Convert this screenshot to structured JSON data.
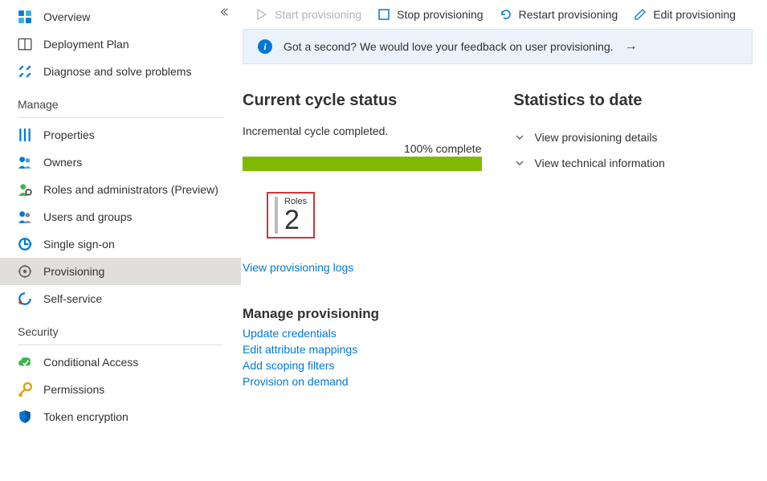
{
  "toolbar": {
    "start": "Start provisioning",
    "stop": "Stop provisioning",
    "restart": "Restart provisioning",
    "edit": "Edit provisioning"
  },
  "banner": {
    "text": "Got a second? We would love your feedback on user provisioning."
  },
  "sidebar": {
    "sections": {
      "top": [
        {
          "id": "overview",
          "label": "Overview"
        },
        {
          "id": "deployment-plan",
          "label": "Deployment Plan"
        },
        {
          "id": "diagnose",
          "label": "Diagnose and solve problems"
        }
      ],
      "manage_header": "Manage",
      "manage": [
        {
          "id": "properties",
          "label": "Properties"
        },
        {
          "id": "owners",
          "label": "Owners"
        },
        {
          "id": "roles-admins",
          "label": "Roles and administrators (Preview)"
        },
        {
          "id": "users-groups",
          "label": "Users and groups"
        },
        {
          "id": "sso",
          "label": "Single sign-on"
        },
        {
          "id": "provisioning",
          "label": "Provisioning",
          "selected": true
        },
        {
          "id": "self-service",
          "label": "Self-service"
        }
      ],
      "security_header": "Security",
      "security": [
        {
          "id": "conditional-access",
          "label": "Conditional Access"
        },
        {
          "id": "permissions",
          "label": "Permissions"
        },
        {
          "id": "token-encryption",
          "label": "Token encryption"
        }
      ]
    }
  },
  "cycle": {
    "heading": "Current cycle status",
    "status": "Incremental cycle completed.",
    "progress_label": "100% complete",
    "progress_pct": 100,
    "roles_label": "Roles",
    "roles_count": "2",
    "view_logs": "View provisioning logs"
  },
  "stats": {
    "heading": "Statistics to date",
    "details": "View provisioning details",
    "technical": "View technical information"
  },
  "manage_prov": {
    "heading": "Manage provisioning",
    "links": [
      "Update credentials",
      "Edit attribute mappings",
      "Add scoping filters",
      "Provision on demand"
    ]
  }
}
